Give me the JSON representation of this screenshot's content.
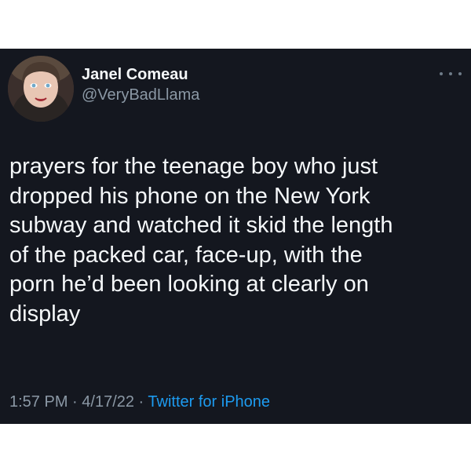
{
  "tweet": {
    "author": {
      "display_name": "Janel Comeau",
      "handle": "@VeryBadLlama",
      "avatar_icon": "profile-photo"
    },
    "more_icon": "more-options-icon",
    "text": "prayers for the teenage boy who just\ndropped his phone on the New York\nsubway and watched it skid the length\nof the packed car, face-up, with the\nporn he’d been looking at clearly on\ndisplay",
    "time": "1:57 PM",
    "separator": " · ",
    "date": "4/17/22",
    "source": "Twitter for iPhone"
  },
  "colors": {
    "card_background": "#14171f",
    "text_primary": "#f5f8fa",
    "text_secondary": "#8b98a5",
    "link": "#1d9bf0"
  }
}
